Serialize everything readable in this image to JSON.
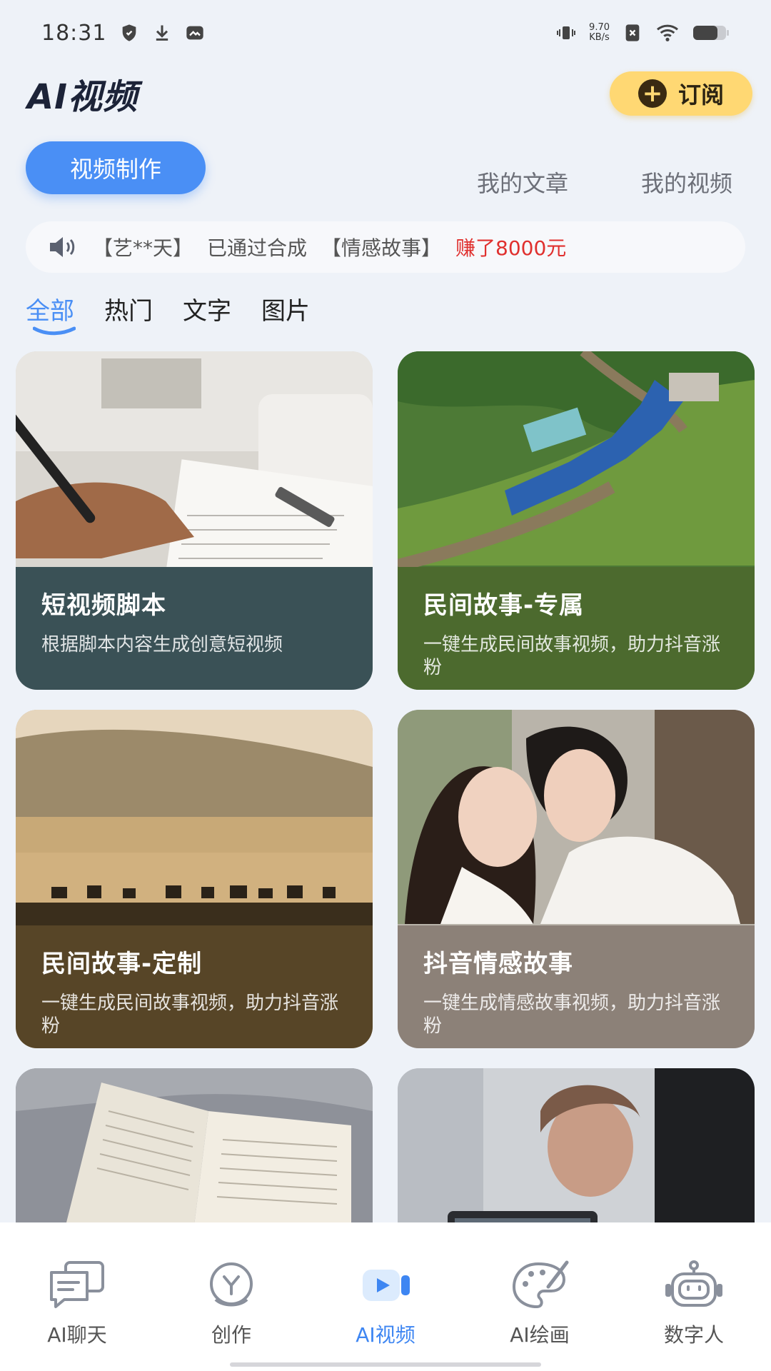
{
  "status_bar": {
    "time": "18:31",
    "net_speed_value": "9.70",
    "net_speed_unit": "KB/s",
    "icons": [
      "shield-icon",
      "download-icon",
      "gallery-icon",
      "vibrate-icon",
      "sim-off-icon",
      "wifi-icon",
      "battery-icon"
    ]
  },
  "header": {
    "title": "AI视频",
    "subscribe_label": "订阅"
  },
  "top_tabs": {
    "primary": "视频制作",
    "my_articles": "我的文章",
    "my_videos": "我的视频"
  },
  "ticker": {
    "user": "【艺**天】",
    "action": "已通过合成",
    "topic": "【情感故事】",
    "earned": "赚了8000元"
  },
  "categories": {
    "items": [
      "全部",
      "热门",
      "文字",
      "图片"
    ],
    "active_index": 0
  },
  "cards": [
    {
      "title": "短视频脚本",
      "desc": "根据脚本内容生成创意短视频",
      "image": "writing-hand-photo"
    },
    {
      "title": "民间故事-专属",
      "desc": "一键生成民间故事视频，助力抖音涨粉",
      "image": "train-landscape-photo"
    },
    {
      "title": "民间故事-定制",
      "desc": "一键生成民间故事视频，助力抖音涨粉",
      "image": "zebra-savanna-photo"
    },
    {
      "title": "抖音情感故事",
      "desc": "一键生成情感故事视频，助力抖音涨粉",
      "image": "couple-photo"
    },
    {
      "title": "",
      "desc": "",
      "image": "open-book-photo"
    },
    {
      "title": "",
      "desc": "",
      "image": "video-camera-photo"
    }
  ],
  "bottom_nav": {
    "items": [
      "AI聊天",
      "创作",
      "AI视频",
      "AI绘画",
      "数字人"
    ],
    "active_index": 2
  },
  "colors": {
    "accent": "#4a8ff5",
    "subscribe": "#ffd873",
    "earn_red": "#e0302e",
    "background": "#eef2f8"
  }
}
